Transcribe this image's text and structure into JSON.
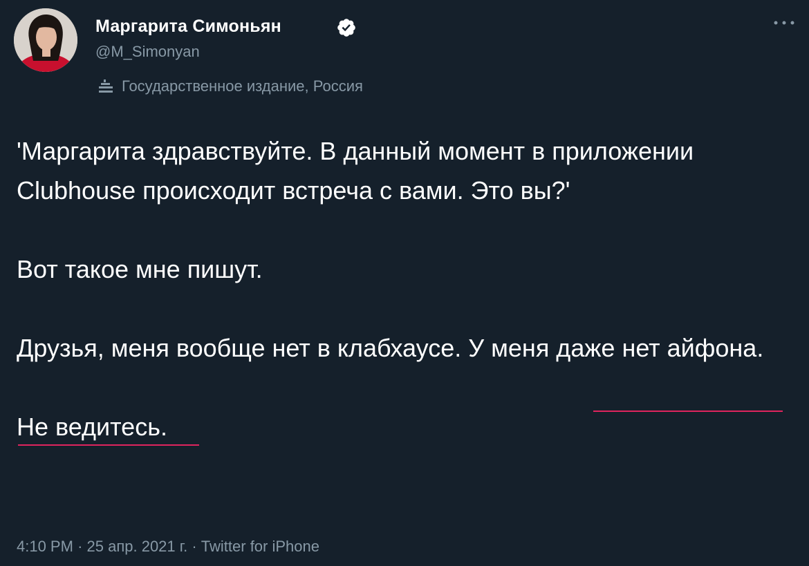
{
  "author": {
    "display_name": "Маргарита Симоньян",
    "handle": "@M_Simonyan",
    "verified": true,
    "label": "Государственное издание, Россия"
  },
  "icons": {
    "verified": "verified-badge-icon",
    "more": "more-options-icon",
    "label": "government-media-icon"
  },
  "tweet": {
    "paragraphs": [
      "'Маргарита здравствуйте. В данный момент в приложении Clubhouse происходит встреча с вами. Это вы?'",
      "Вот такое мне пишут.",
      "Друзья, меня вообще нет в клабхаусе. У меня даже нет айфона.",
      "Не ведитесь."
    ]
  },
  "meta": {
    "time": "4:10 PM",
    "date": "25 апр. 2021 г.",
    "source": "Twitter for iPhone",
    "separator": "·"
  },
  "colors": {
    "background": "#15202b",
    "text": "#ffffff",
    "secondary": "#8899a6",
    "accent": "#1da1f2",
    "underline": "#e0245e"
  }
}
